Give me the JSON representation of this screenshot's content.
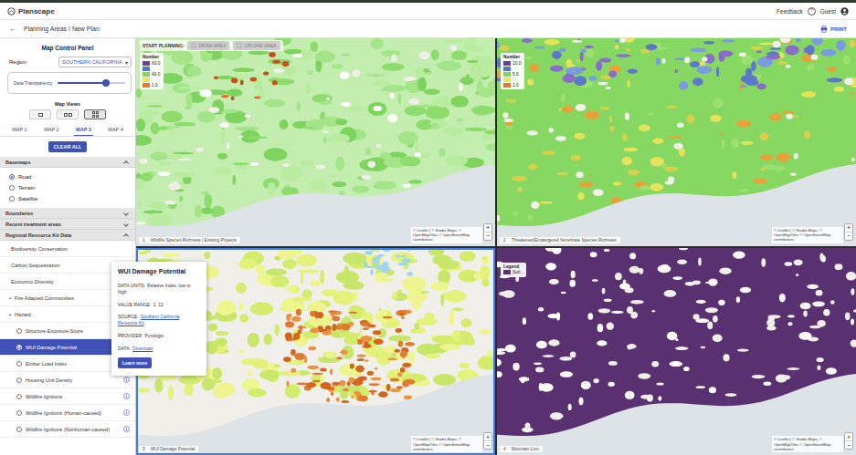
{
  "header": {
    "logo": "Planscape",
    "feedback": "Feedback",
    "help": "?",
    "user": "Guest"
  },
  "breadcrumb": {
    "back": "←",
    "path": "Planning Areas / New Plan",
    "print": "PRINT"
  },
  "sidebar": {
    "title": "Map Control Panel",
    "region": {
      "label": "Region",
      "value": "SOUTHERN CALIFORNIA",
      "arrow": "▾"
    },
    "transparency": {
      "label": "Data Transparency",
      "level": 0.72
    },
    "map_views": {
      "label": "Map Views",
      "options": [
        {
          "kind": "single",
          "selected": false
        },
        {
          "kind": "double",
          "selected": false
        },
        {
          "kind": "quad",
          "selected": true
        }
      ]
    },
    "map_tabs": [
      {
        "label": "MAP 1",
        "selected": false
      },
      {
        "label": "MAP 2",
        "selected": false
      },
      {
        "label": "MAP 3",
        "selected": true
      },
      {
        "label": "MAP 4",
        "selected": false
      }
    ],
    "clear_all": "CLEAR ALL",
    "sections": [
      {
        "title": "Basemaps",
        "expanded": true,
        "kind": "radios",
        "items": [
          {
            "label": "Road",
            "selected": true
          },
          {
            "label": "Terrain",
            "selected": false
          },
          {
            "label": "Satellite",
            "selected": false
          }
        ]
      },
      {
        "title": "Boundaries",
        "expanded": false,
        "kind": "none",
        "items": []
      },
      {
        "title": "Recent treatment areas",
        "expanded": false,
        "kind": "none",
        "items": []
      },
      {
        "title": "Regional Resource Kit Data",
        "expanded": true,
        "kind": "tree",
        "items": [
          {
            "kind": "category",
            "label": "Biodiversity Conservation",
            "bullet": "",
            "selected": false
          },
          {
            "kind": "category",
            "label": "Carbon Sequestration",
            "bullet": "",
            "selected": false
          },
          {
            "kind": "category",
            "label": "Economic Diversity",
            "bullet": "",
            "selected": false
          },
          {
            "kind": "group",
            "label": "Fire Adapted Communities",
            "bullet": "•",
            "selected": false
          },
          {
            "kind": "group",
            "label": "Hazard",
            "bullet": "•",
            "selected": false
          },
          {
            "kind": "radio",
            "label": "Structure Exposure Score",
            "bullet": "",
            "selected": false
          },
          {
            "kind": "radio",
            "label": "WUI Damage Potential",
            "bullet": "",
            "selected": true
          },
          {
            "kind": "radio",
            "label": "Ember Load Index",
            "bullet": "",
            "selected": false
          },
          {
            "kind": "radio",
            "label": "Housing Unit Density",
            "bullet": "",
            "selected": false
          },
          {
            "kind": "radio",
            "label": "Wildfire Ignitions",
            "bullet": "",
            "selected": false
          },
          {
            "kind": "radio",
            "label": "Wildfire Ignitions (Human-caused)",
            "bullet": "",
            "selected": false
          },
          {
            "kind": "radio",
            "label": "Wildfire Ignitions (Nonhuman-caused)",
            "bullet": "",
            "selected": false
          }
        ]
      }
    ]
  },
  "tooltip": {
    "title": "WUI Damage Potential",
    "rows": [
      {
        "label": "DATA UNITS:",
        "value": "Relative Index, low to high",
        "link": false
      },
      {
        "label": "VALUE RANGE:",
        "value": "1, 12",
        "link": false
      },
      {
        "label": "SOURCE:",
        "value": "Southern California Resource Kit",
        "link": true
      },
      {
        "label": "PROVIDER:",
        "value": "Pyrologix",
        "link": false
      },
      {
        "label": "DATA:",
        "value": "Download",
        "link": true
      }
    ],
    "button": "Learn more"
  },
  "start_planning": {
    "label": "START PLANNING:",
    "buttons": [
      {
        "label": "DRAW AREA",
        "disabled": true
      },
      {
        "label": "UPLOAD AREA",
        "disabled": true
      }
    ]
  },
  "map_controls": {
    "zoom_in": "+",
    "zoom_out": "−",
    "attribution": "© Leaflet | © Stadia Maps, © OpenMapTiles © OpenStreetMap contributors"
  },
  "maps": [
    {
      "number": "1",
      "title": "Wildlife Species Richness | Existing Projects",
      "selected": false,
      "legend": {
        "title": "Number",
        "entries": [
          {
            "label": "60.0",
            "color": "#6a3d9a"
          },
          {
            "label": "",
            "color": "#4e79c9"
          },
          {
            "label": "40.0",
            "color": "#7ed957"
          },
          {
            "label": "",
            "color": "#e6e65a"
          },
          {
            "label": "1.0",
            "color": "#e8762d"
          }
        ]
      }
    },
    {
      "number": "2",
      "title": "Threatened/Endangered Vertebrate Species Richness",
      "selected": false,
      "legend": {
        "title": "Number",
        "entries": [
          {
            "label": "10.0",
            "color": "#6a3d9a"
          },
          {
            "label": "",
            "color": "#4e79c9"
          },
          {
            "label": "5.0",
            "color": "#7ed957"
          },
          {
            "label": "",
            "color": "#e6e65a"
          },
          {
            "label": "1.0",
            "color": "#e8762d"
          }
        ]
      }
    },
    {
      "number": "3",
      "title": "WUI Damage Potential",
      "selected": true,
      "legend": null
    },
    {
      "number": "4",
      "title": "Mountain Lion",
      "selected": false,
      "legend": {
        "title": "Legend",
        "entries": [
          {
            "label": "Suit...",
            "color": "#5a3170"
          }
        ]
      }
    }
  ]
}
